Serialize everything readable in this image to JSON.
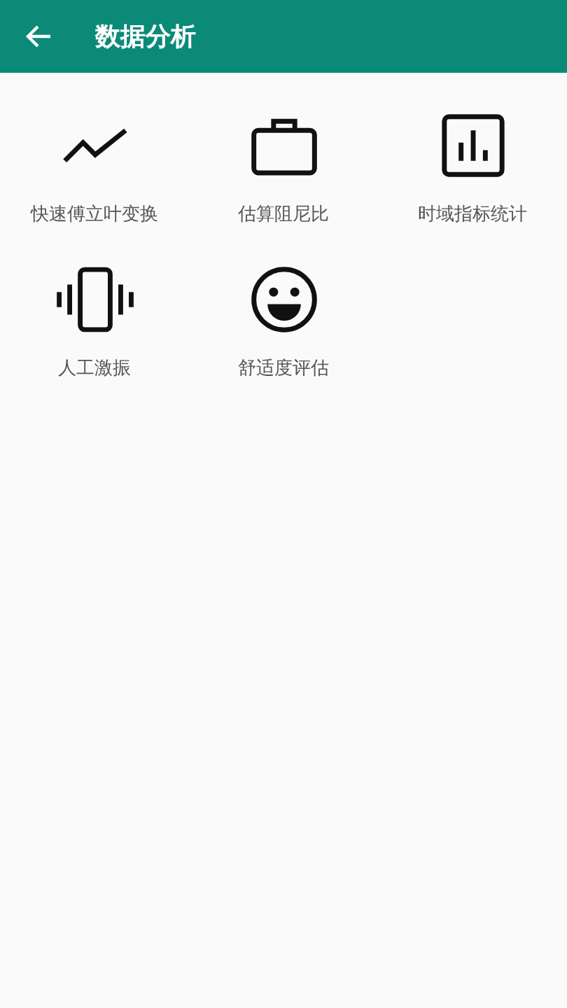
{
  "app_bar": {
    "title": "数据分析"
  },
  "items": [
    {
      "kind": "trend",
      "label": "快速傅立叶变换"
    },
    {
      "kind": "briefcase",
      "label": "估算阻尼比"
    },
    {
      "kind": "bars",
      "label": "时域指标统计"
    },
    {
      "kind": "vibrate",
      "label": "人工激振"
    },
    {
      "kind": "smile",
      "label": "舒适度评估"
    }
  ]
}
